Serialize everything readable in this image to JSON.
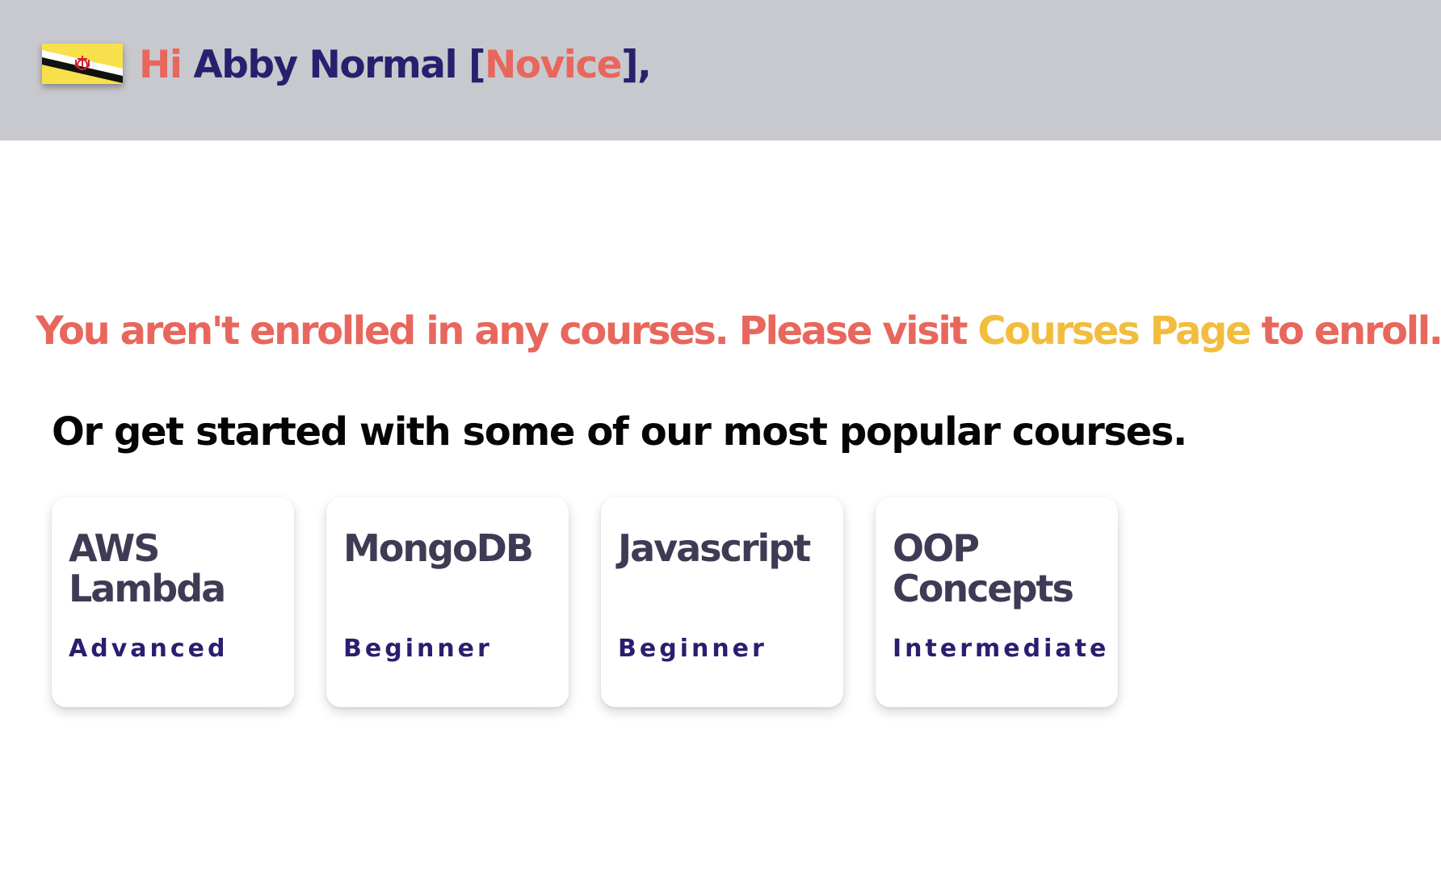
{
  "header": {
    "flag_icon": "brunei-flag-icon",
    "greeting_hi": "Hi",
    "user_name": "Abby Normal",
    "bracket_open": "[",
    "rank": "Novice",
    "bracket_close": "],"
  },
  "notice": {
    "text_before": "You aren't enrolled in any courses. Please visit ",
    "link_text": "Courses Page",
    "text_after": " to enroll."
  },
  "subtitle": "Or get started with some of our most popular courses.",
  "courses": [
    {
      "title_line1": "AWS",
      "title_line2": "Lambda",
      "level": "Advanced"
    },
    {
      "title_line1": "MongoDB",
      "title_line2": "",
      "level": "Beginner"
    },
    {
      "title_line1": "Javascript",
      "title_line2": "",
      "level": "Beginner"
    },
    {
      "title_line1": "OOP",
      "title_line2": "Concepts",
      "level": "Intermediate"
    }
  ],
  "colors": {
    "header_bg": "#c8c9ce",
    "accent_coral": "#e8675d",
    "accent_navy": "#2a1f6e",
    "accent_yellow": "#f2bd3e",
    "card_title": "#3e3b54"
  }
}
